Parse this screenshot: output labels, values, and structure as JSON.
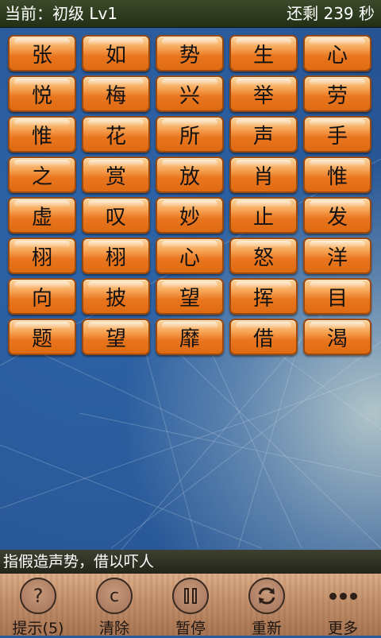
{
  "status": {
    "level": "当前：初级 Lv1",
    "timer": "还剩 239 秒"
  },
  "grid": [
    [
      "张",
      "如",
      "势",
      "生",
      "心"
    ],
    [
      "悦",
      "梅",
      "兴",
      "举",
      "劳"
    ],
    [
      "惟",
      "花",
      "所",
      "声",
      "手"
    ],
    [
      "之",
      "赏",
      "放",
      "肖",
      "惟"
    ],
    [
      "虚",
      "叹",
      "妙",
      "止",
      "发"
    ],
    [
      "栩",
      "栩",
      "心",
      "怒",
      "洋"
    ],
    [
      "向",
      "披",
      "望",
      "挥",
      "目"
    ],
    [
      "题",
      "望",
      "靡",
      "借",
      "渴"
    ]
  ],
  "hint": "指假造声势，借以吓人",
  "toolbar": {
    "hint_label": "提示(5)",
    "clear_label": "清除",
    "pause_label": "暂停",
    "renew_label": "重新",
    "more_label": "更多"
  },
  "icons": {
    "hint": "question-icon",
    "clear": "clear-c-icon",
    "pause": "pause-icon",
    "renew": "refresh-icon",
    "more": "more-dots-icon"
  },
  "colors": {
    "tile": "#ee8a2e",
    "status_bg": "#2e3b20",
    "toolbar_bg": "#c48e66"
  }
}
